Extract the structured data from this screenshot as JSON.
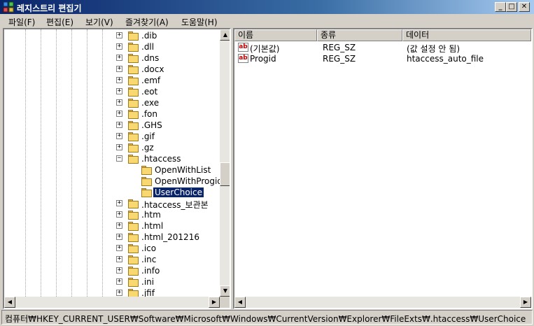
{
  "window": {
    "title": "레지스트리 편집기",
    "buttons": {
      "minimize": "_",
      "maximize": "□",
      "close": "✕"
    }
  },
  "menu": [
    "파일(F)",
    "편집(E)",
    "보기(V)",
    "즐겨찾기(A)",
    "도움말(H)"
  ],
  "tree": {
    "items": [
      {
        "label": ".dib",
        "expander": "+"
      },
      {
        "label": ".dll",
        "expander": "+"
      },
      {
        "label": ".dns",
        "expander": "+"
      },
      {
        "label": ".docx",
        "expander": "+"
      },
      {
        "label": ".emf",
        "expander": "+"
      },
      {
        "label": ".eot",
        "expander": "+"
      },
      {
        "label": ".exe",
        "expander": "+"
      },
      {
        "label": ".fon",
        "expander": "+"
      },
      {
        "label": ".GHS",
        "expander": "+"
      },
      {
        "label": ".gif",
        "expander": "+"
      },
      {
        "label": ".gz",
        "expander": "+"
      },
      {
        "label": ".htaccess",
        "expander": "−"
      },
      {
        "label": "OpenWithList",
        "expander": ""
      },
      {
        "label": "OpenWithProgids",
        "expander": ""
      },
      {
        "label": "UserChoice",
        "expander": "",
        "selected": true
      },
      {
        "label": ".htaccess_보관본",
        "expander": "+"
      },
      {
        "label": ".htm",
        "expander": "+"
      },
      {
        "label": ".html",
        "expander": "+"
      },
      {
        "label": ".html_201216",
        "expander": "+"
      },
      {
        "label": ".ico",
        "expander": "+"
      },
      {
        "label": ".inc",
        "expander": "+"
      },
      {
        "label": ".info",
        "expander": "+"
      },
      {
        "label": ".ini",
        "expander": "+"
      },
      {
        "label": ".jfif",
        "expander": "+"
      }
    ]
  },
  "list": {
    "columns": [
      "이름",
      "종류",
      "데이터"
    ],
    "rows": [
      {
        "icon": "ab",
        "name": "(기본값)",
        "type": "REG_SZ",
        "data": "(값 설정 안 됨)"
      },
      {
        "icon": "ab",
        "name": "Progid",
        "type": "REG_SZ",
        "data": "htaccess_auto_file"
      }
    ]
  },
  "scroll": {
    "up": "▲",
    "down": "▼",
    "left": "◀",
    "right": "▶",
    "tree_vertical_position": 0.55
  },
  "statusbar": {
    "path": "컴퓨터₩HKEY_CURRENT_USER₩Software₩Microsoft₩Windows₩CurrentVersion₩Explorer₩FileExts₩.htaccess₩UserChoice"
  },
  "icons": {
    "app": "registry-editor-icon",
    "folder": "folder-icon",
    "value": "string-value-icon"
  },
  "colors": {
    "titlebar_start": "#0a246a",
    "selection": "#0a246a",
    "folder": "#f8d870",
    "value_icon_text": "#c00000"
  }
}
